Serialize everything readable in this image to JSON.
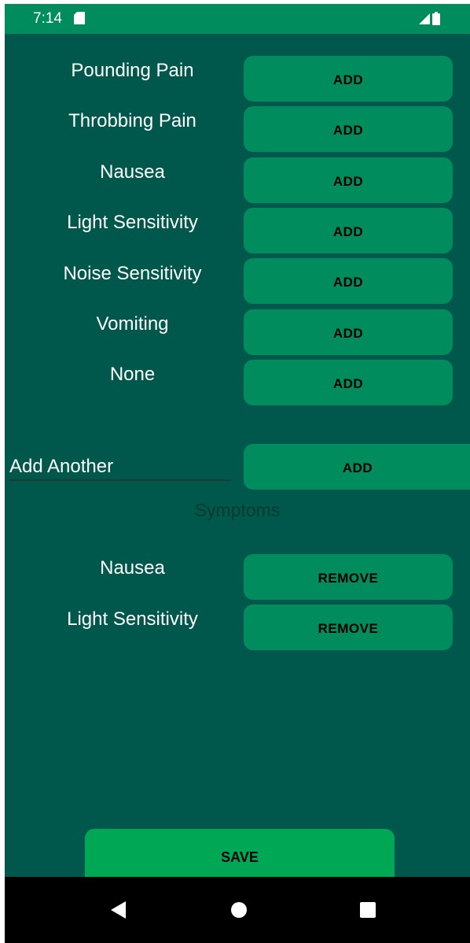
{
  "status_bar": {
    "time": "7:14"
  },
  "symptom_options": [
    {
      "label": "Pounding Pain",
      "button": "ADD"
    },
    {
      "label": "Throbbing Pain",
      "button": "ADD"
    },
    {
      "label": "Nausea",
      "button": "ADD"
    },
    {
      "label": "Light Sensitivity",
      "button": "ADD"
    },
    {
      "label": "Noise Sensitivity",
      "button": "ADD"
    },
    {
      "label": "Vomiting",
      "button": "ADD"
    },
    {
      "label": "None",
      "button": "ADD"
    }
  ],
  "add_another": {
    "value": "Add Another",
    "button": "ADD"
  },
  "section_title": "Symptoms",
  "selected_symptoms": [
    {
      "label": "Nausea",
      "button": "REMOVE"
    },
    {
      "label": "Light Sensitivity",
      "button": "REMOVE"
    }
  ],
  "save_label": "SAVE",
  "colors": {
    "background": "#00574b",
    "button": "#008c5d",
    "save_button": "#00a855"
  },
  "nav_icons": [
    "back-icon",
    "home-icon",
    "recents-icon"
  ]
}
